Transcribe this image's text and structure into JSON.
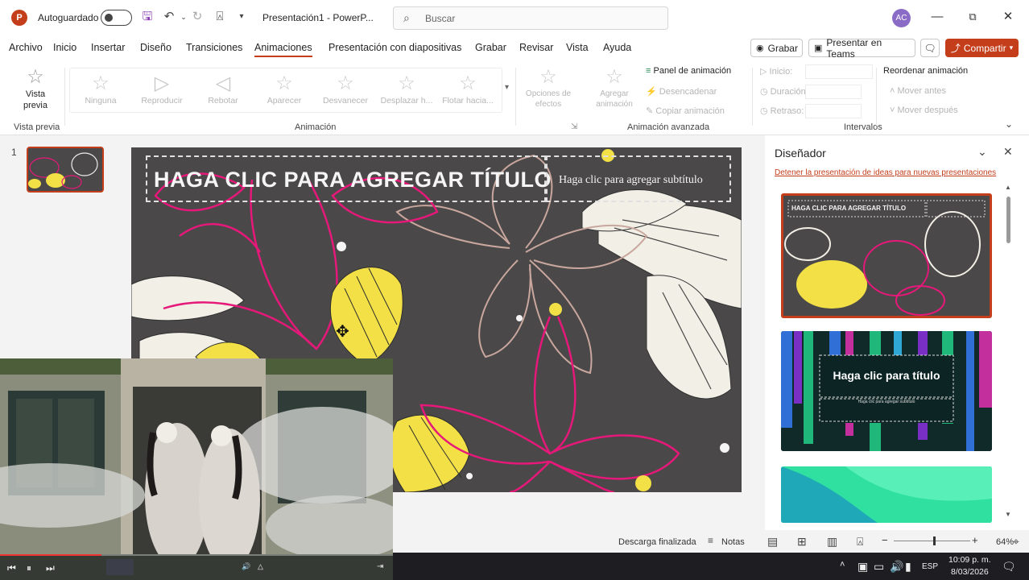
{
  "titlebar": {
    "app_logo": "P",
    "autosave_label": "Autoguardado",
    "doc_title": "Presentación1  -  PowerP...",
    "search_placeholder": "Buscar",
    "avatar_initials": "AC"
  },
  "menu": {
    "tabs": [
      "Archivo",
      "Inicio",
      "Insertar",
      "Diseño",
      "Transiciones",
      "Animaciones",
      "Presentación con diapositivas",
      "Grabar",
      "Revisar",
      "Vista",
      "Ayuda"
    ],
    "active_tab": "Animaciones",
    "record_label": "Grabar",
    "teams_label": "Presentar en Teams",
    "share_label": "Compartir"
  },
  "ribbon": {
    "preview_label": "Vista previa",
    "gallery": [
      "Ninguna",
      "Reproducir",
      "Rebotar",
      "Aparecer",
      "Desvanecer",
      "Desplazar h...",
      "Flotar hacia..."
    ],
    "effect_options_label": "Opciones de efectos",
    "add_animation_label": "Agregar animación",
    "animation_panel_label": "Panel de animación",
    "trigger_label": "Desencadenar",
    "copy_animation_label": "Copiar animación",
    "start_label": "Inicio:",
    "duration_label": "Duración:",
    "delay_label": "Retraso:",
    "reorder_label": "Reordenar animación",
    "move_earlier_label": "Mover antes",
    "move_later_label": "Mover después",
    "groups": [
      "Vista previa",
      "Animación",
      "Animación avanzada",
      "Intervalos"
    ]
  },
  "thumbnails": {
    "slide_number": "1"
  },
  "slide": {
    "title_placeholder": "HAGA CLIC PARA AGREGAR TÍTULO",
    "subtitle_placeholder": "Haga clic para agregar subtítulo"
  },
  "designer": {
    "title": "Diseñador",
    "stop_link": "Detener la presentación de ideas para nuevas presentaciones",
    "card1_title": "HAGA CLIC PARA AGREGAR TÍTULO",
    "card2_title": "Haga clic para título",
    "card2_sub": "Haga clic para agregar subtítulo"
  },
  "statusbar": {
    "download_status": "Descarga finalizada",
    "notes_label": "Notas",
    "zoom": "64%",
    "zoom_level_fraction": 0.64
  },
  "taskbar": {
    "language": "ESP",
    "time": "10:09 p. m.",
    "date": "8/03/2026"
  },
  "colors": {
    "accent": "#c43e1c",
    "slide_bg": "#4a4848",
    "pink": "#e6187a",
    "yellow": "#f2e046"
  }
}
